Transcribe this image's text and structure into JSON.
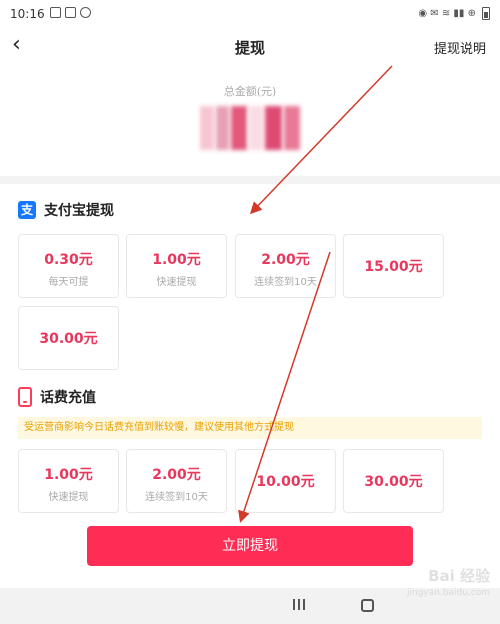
{
  "status_bar": {
    "time": "10:16",
    "right_text": "◉ ✉ ≋ ▮▮ ⊕"
  },
  "nav": {
    "title": "提现",
    "help": "提现说明"
  },
  "balance": {
    "label": "总金额(元)"
  },
  "alipay": {
    "title": "支付宝提现",
    "options": [
      {
        "amount": "0.30元",
        "sub": "每天可提"
      },
      {
        "amount": "1.00元",
        "sub": "快速提现"
      },
      {
        "amount": "2.00元",
        "sub": "连续签到10天"
      },
      {
        "amount": "15.00元",
        "sub": ""
      },
      {
        "amount": "30.00元",
        "sub": ""
      }
    ]
  },
  "phone": {
    "title": "话费充值",
    "notice": "受运营商影响今日话费充值到账较慢，建议使用其他方式提现",
    "options": [
      {
        "amount": "1.00元",
        "sub": "快速提现"
      },
      {
        "amount": "2.00元",
        "sub": "连续签到10天"
      },
      {
        "amount": "10.00元",
        "sub": ""
      },
      {
        "amount": "30.00元",
        "sub": ""
      }
    ]
  },
  "button": {
    "label": "立即提现"
  },
  "watermark": {
    "brand": "Bai 经验",
    "url": "jingyan.baidu.com"
  },
  "colors": {
    "accent": "#ff2d55",
    "amount": "#e8365c",
    "alipay": "#1677ff",
    "annotation": "#d23a2a"
  },
  "icons": {
    "back": "chevron-left-icon",
    "alipay": "alipay-icon",
    "phone": "phone-icon"
  }
}
